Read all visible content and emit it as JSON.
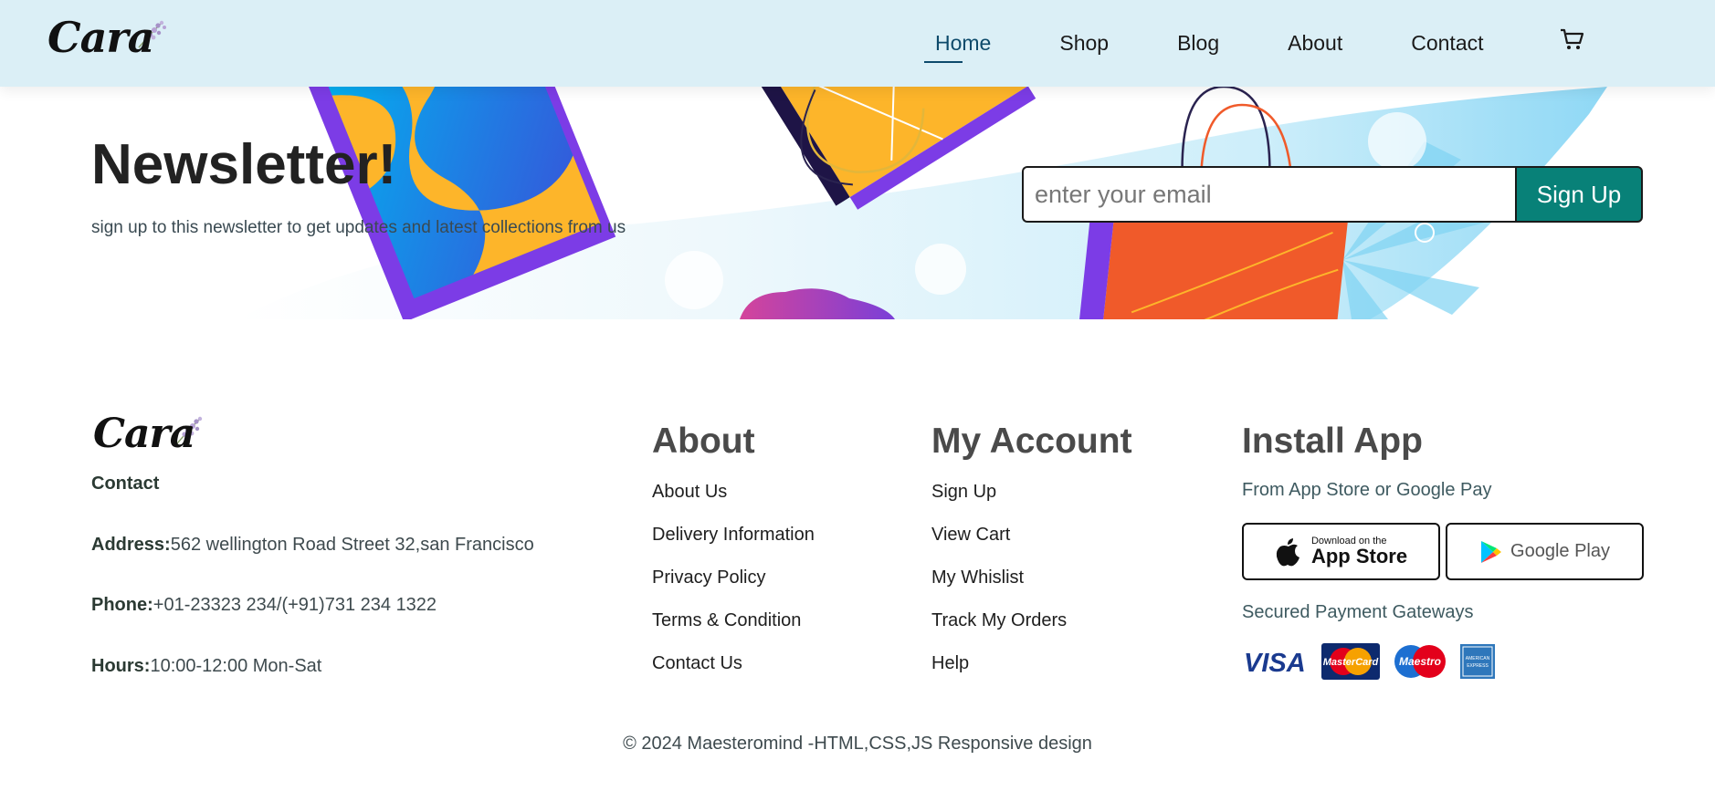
{
  "brand": {
    "logo_text": "Cara"
  },
  "nav": {
    "items": [
      "Home",
      "Shop",
      "Blog",
      "About",
      "Contact"
    ],
    "active": "Home"
  },
  "newsletter": {
    "title": "Newsletter!",
    "subtitle": "sign up to this newsletter to get updates and latest collections from us",
    "email_placeholder": "enter your email",
    "button_label": "Sign Up"
  },
  "footer": {
    "contact": {
      "heading": "Contact",
      "address_label": "Address:",
      "address": "562 wellington Road Street 32,san Francisco",
      "phone_label": "Phone:",
      "phone": "+01-23323 234/(+91)731 234 1322",
      "hours_label": "Hours:",
      "hours": "10:00-12:00 Mon-Sat"
    },
    "about": {
      "title": "About",
      "links": [
        "About Us",
        "Delivery Information",
        "Privacy Policy",
        "Terms & Condition",
        "Contact Us"
      ]
    },
    "account": {
      "title": "My Account",
      "links": [
        "Sign Up",
        "View Cart",
        "My Whislist",
        "Track My Orders",
        "Help"
      ]
    },
    "install": {
      "title": "Install App",
      "subtitle": "From App Store or Google Pay",
      "app_store_small": "Download on the",
      "app_store_big": "App Store",
      "google_play": "Google Play",
      "secured": "Secured Payment Gateways",
      "payments": [
        "VISA",
        "MasterCard",
        "Maestro",
        "AMERICAN EXPRESS"
      ]
    },
    "copyright": "© 2024 Maesteromind -HTML,CSS,JS Responsive design"
  },
  "colors": {
    "header_bg": "#dbeff6",
    "accent": "#088178",
    "nav_active": "#0d4a6b"
  }
}
